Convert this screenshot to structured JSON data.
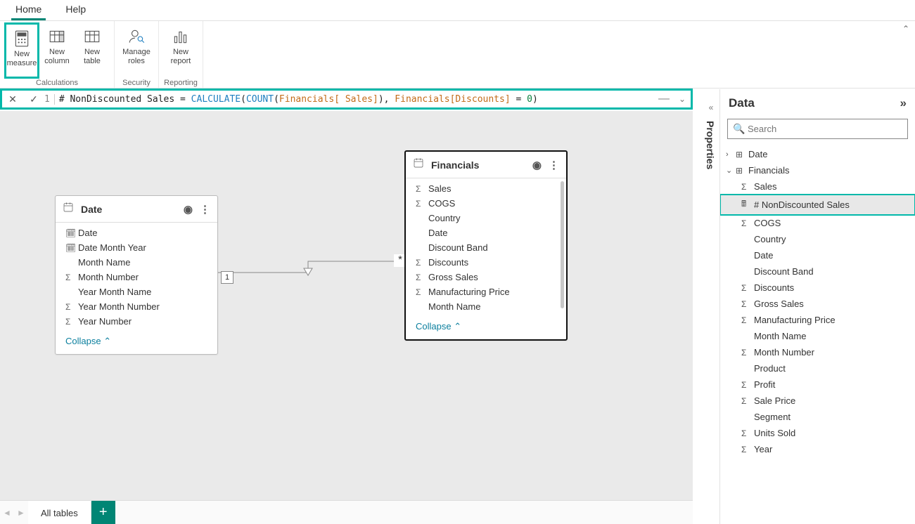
{
  "tabs": {
    "home": "Home",
    "help": "Help"
  },
  "ribbon": {
    "calculations_label": "Calculations",
    "security_label": "Security",
    "reporting_label": "Reporting",
    "new_measure1": "New",
    "new_measure2": "measure",
    "new_column1": "New",
    "new_column2": "column",
    "new_table1": "New",
    "new_table2": "table",
    "manage_roles1": "Manage",
    "manage_roles2": "roles",
    "new_report1": "New",
    "new_report2": "report"
  },
  "formula": {
    "line": "1",
    "t1": "# NonDiscounted Sales = ",
    "fn1": "CALCULATE",
    "p1": "(",
    "fn2": "COUNT",
    "p2": "(",
    "col1": "Financials[ Sales]",
    "p3": "), ",
    "col2": "Financials[Discounts]",
    "p4": " = ",
    "num": "0",
    "p5": ")"
  },
  "date_table": {
    "title": "Date",
    "fields": {
      "date": "Date",
      "date_month_year": "Date Month Year",
      "month_name": "Month Name",
      "month_number": "Month Number",
      "year_month_name": "Year Month Name",
      "year_month_number": "Year Month Number",
      "year_number": "Year Number"
    },
    "collapse": "Collapse"
  },
  "fin_table": {
    "title": "Financials",
    "fields": {
      "sales": "Sales",
      "cogs": "COGS",
      "country": "Country",
      "date": "Date",
      "discount_band": "Discount Band",
      "discounts": "Discounts",
      "gross_sales": "Gross Sales",
      "manufacturing_price": "Manufacturing Price",
      "month_name": "Month Name"
    },
    "collapse": "Collapse"
  },
  "rel": {
    "one": "1",
    "many": "*"
  },
  "props_tab": "Properties",
  "data_pane": {
    "title": "Data",
    "search_placeholder": "Search",
    "tree": {
      "date": "Date",
      "financials": "Financials",
      "fields": {
        "sales": "Sales",
        "nondiscounted": "# NonDiscounted Sales",
        "cogs": "COGS",
        "country": "Country",
        "date": "Date",
        "discount_band": "Discount Band",
        "discounts": "Discounts",
        "gross_sales": "Gross Sales",
        "manufacturing_price": "Manufacturing Price",
        "month_name": "Month Name",
        "month_number": "Month Number",
        "product": "Product",
        "profit": "Profit",
        "sale_price": "Sale Price",
        "segment": "Segment",
        "units_sold": "Units Sold",
        "year": "Year"
      }
    }
  },
  "bottom": {
    "all_tables": "All tables"
  },
  "glyph": {
    "sigma": "Σ",
    "calendar": "📅",
    "table": "⊞",
    "measure": "🖩"
  }
}
